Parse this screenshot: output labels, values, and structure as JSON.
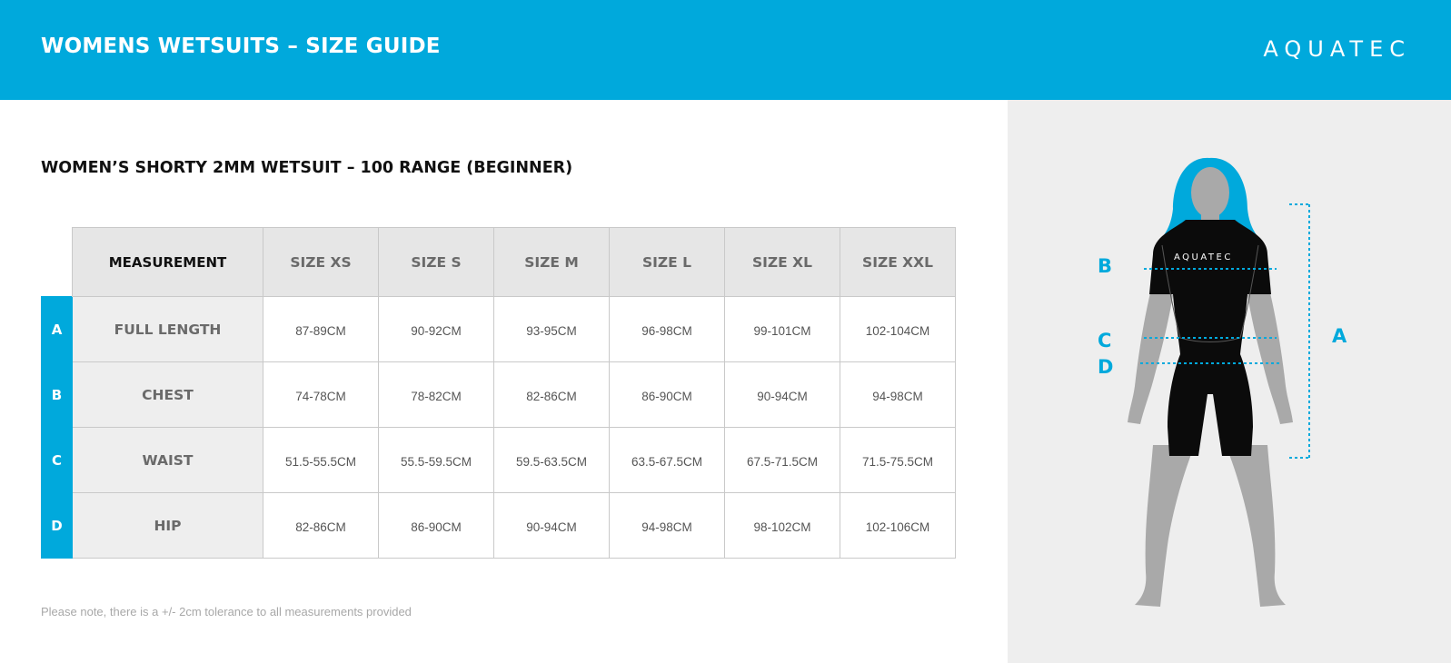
{
  "header": {
    "title": "WOMENS WETSUITS – SIZE GUIDE",
    "brand": "AQUATEC"
  },
  "section": {
    "title": "WOMEN’S SHORTY 2MM WETSUIT – 100 RANGE (BEGINNER)"
  },
  "table": {
    "measurement_header": "MEASUREMENT",
    "size_headers": [
      "SIZE XS",
      "SIZE S",
      "SIZE M",
      "SIZE L",
      "SIZE XL",
      "SIZE XXL"
    ],
    "rows": [
      {
        "letter": "A",
        "measurement": "FULL LENGTH",
        "values": [
          "87-89CM",
          "90-92CM",
          "93-95CM",
          "96-98CM",
          "99-101CM",
          "102-104CM"
        ]
      },
      {
        "letter": "B",
        "measurement": "CHEST",
        "values": [
          "74-78CM",
          "78-82CM",
          "82-86CM",
          "86-90CM",
          "90-94CM",
          "94-98CM"
        ]
      },
      {
        "letter": "C",
        "measurement": "WAIST",
        "values": [
          "51.5-55.5CM",
          "55.5-59.5CM",
          "59.5-63.5CM",
          "63.5-67.5CM",
          "67.5-71.5CM",
          "71.5-75.5CM"
        ]
      },
      {
        "letter": "D",
        "measurement": "HIP",
        "values": [
          "82-86CM",
          "86-90CM",
          "90-94CM",
          "94-98CM",
          "98-102CM",
          "102-106CM"
        ]
      }
    ]
  },
  "footnote": "Please note, there is a +/- 2cm tolerance to all measurements provided",
  "figure": {
    "suit_brand": "AQUATEC",
    "labels": {
      "a": "A",
      "b": "B",
      "c": "C",
      "d": "D"
    }
  },
  "colors": {
    "accent": "#00a9dc",
    "panel": "#eeeeee",
    "suit": "#0b0b0b",
    "skin": "#a9a9a9"
  }
}
